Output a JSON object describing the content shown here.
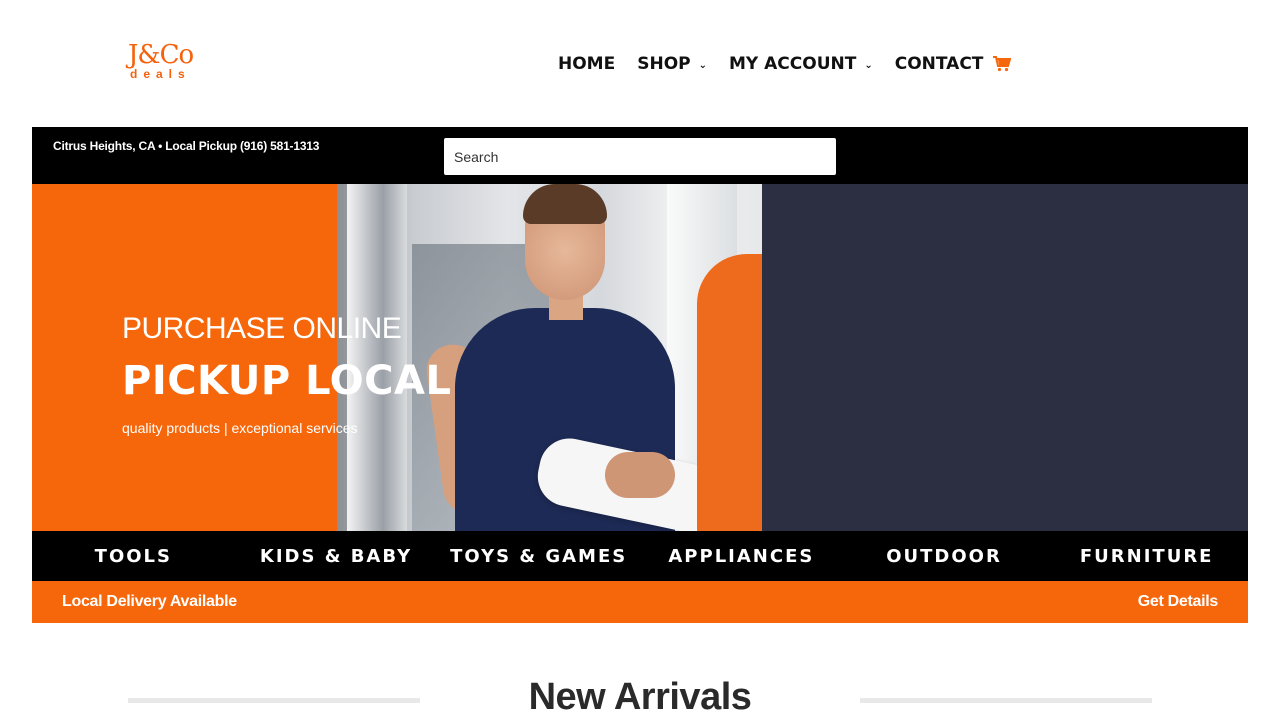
{
  "logo": {
    "top": "J&Co",
    "bottom": "deals"
  },
  "nav": {
    "items": [
      {
        "label": "HOME",
        "dropdown": false
      },
      {
        "label": "SHOP",
        "dropdown": true
      },
      {
        "label": "MY ACCOUNT",
        "dropdown": true
      },
      {
        "label": "CONTACT",
        "dropdown": false
      }
    ],
    "cart_icon": "cart-icon"
  },
  "topbar": {
    "info": "Citrus Heights, CA • Local Pickup  (916) 581-1313",
    "search_placeholder": "Search"
  },
  "hero": {
    "subtitle": "PURCHASE ONLINE",
    "title": "PICKUP LOCAL",
    "tagline": "quality products | exceptional services"
  },
  "categories": [
    "TOOLS",
    "KIDS & BABY",
    "TOYS & GAMES",
    "APPLIANCES",
    "OUTDOOR",
    "FURNITURE"
  ],
  "delivery": {
    "left": "Local Delivery Available",
    "right": "Get Details"
  },
  "section": {
    "title": "New Arrivals"
  },
  "colors": {
    "accent": "#f6660a",
    "dark": "#000000",
    "hero_right": "#2c2e42"
  }
}
